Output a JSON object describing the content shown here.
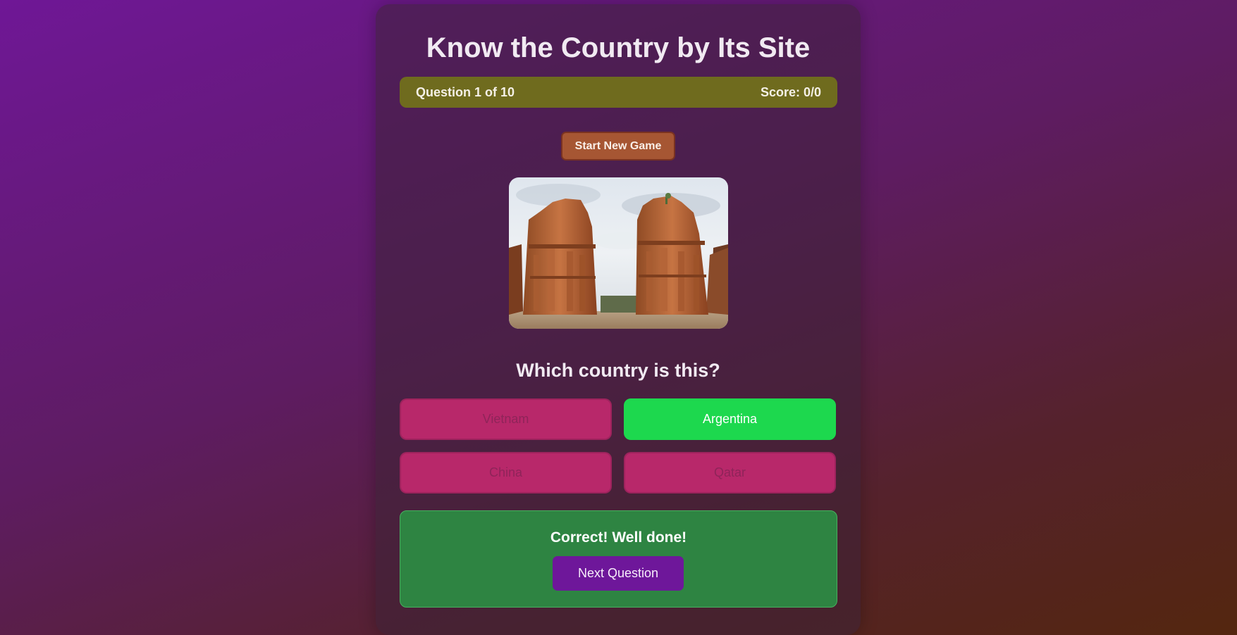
{
  "app": {
    "title": "Know the Country by Its Site"
  },
  "status": {
    "question_progress": "Question 1 of 10",
    "score": "Score: 0/0"
  },
  "controls": {
    "start_label": "Start New Game"
  },
  "quiz": {
    "prompt": "Which country is this?",
    "options": [
      {
        "label": "Vietnam",
        "state": "disabled"
      },
      {
        "label": "Argentina",
        "state": "correct"
      },
      {
        "label": "China",
        "state": "disabled"
      },
      {
        "label": "Qatar",
        "state": "disabled"
      }
    ]
  },
  "feedback": {
    "message": "Correct! Well done!",
    "next_label": "Next Question"
  },
  "colors": {
    "correct": "#1dd84e",
    "option": "#b8286a",
    "status_bar": "#6f6b1e",
    "next_button": "#6e179a",
    "feedback_panel": "#2e8442"
  }
}
